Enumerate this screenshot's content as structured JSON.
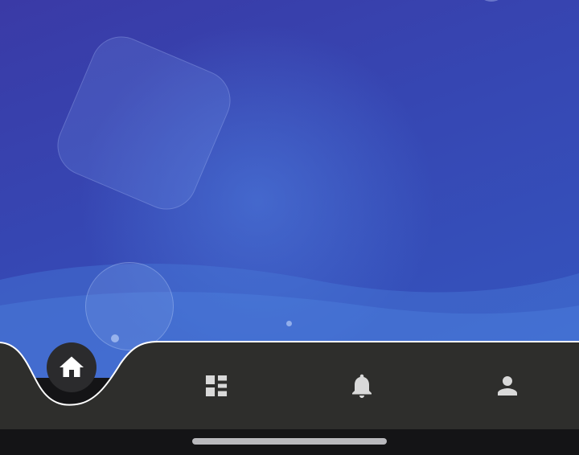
{
  "navigation": {
    "active_tab": "home",
    "tabs": [
      {
        "id": "home",
        "icon": "home-icon",
        "active": true
      },
      {
        "id": "dashboard",
        "icon": "dashboard-icon",
        "active": false
      },
      {
        "id": "notifications",
        "icon": "bell-icon",
        "active": false
      },
      {
        "id": "profile",
        "icon": "person-icon",
        "active": false
      }
    ]
  },
  "colors": {
    "wallpaper_top": "#3a3aa6",
    "wallpaper_bottom": "#3456bf",
    "navbar_background": "#2e2e2c",
    "active_bubble": "#2b2b2d",
    "icon": "#d9d9d9",
    "home_indicator": "#b9b9bd"
  }
}
